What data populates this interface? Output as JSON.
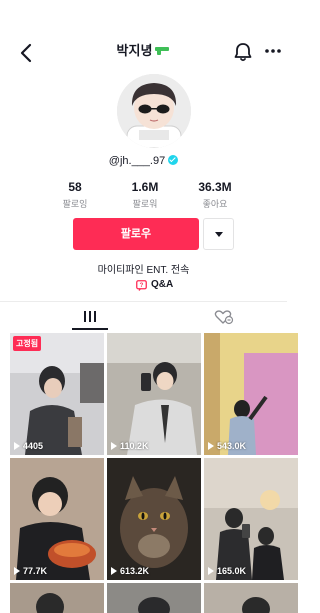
{
  "header": {
    "title": "박지녕"
  },
  "profile": {
    "handle": "@jh.___.97"
  },
  "stats": [
    {
      "value": "58",
      "label": "팔로잉"
    },
    {
      "value": "1.6M",
      "label": "팔로워"
    },
    {
      "value": "36.3M",
      "label": "좋아요"
    }
  ],
  "actions": {
    "follow_label": "팔로우"
  },
  "bio": "마이티파인 ENT. 전속",
  "qa": {
    "label": "Q&A"
  },
  "videos": [
    {
      "views": "4405",
      "badge": "고정됨",
      "caption": ""
    },
    {
      "views": "110.2K",
      "badge": "",
      "caption": ""
    },
    {
      "views": "543.0K",
      "badge": "",
      "caption": ""
    },
    {
      "views": "77.7K",
      "badge": "",
      "caption": ""
    },
    {
      "views": "613.2K",
      "badge": "",
      "caption": ""
    },
    {
      "views": "165.0K",
      "badge": "",
      "caption": ""
    }
  ],
  "colors": {
    "accent": "#fe2c55",
    "verified": "#20d5ec"
  },
  "icons": [
    "back-icon",
    "gun-emoji-icon",
    "bell-icon",
    "more-icon",
    "verified-icon",
    "dropdown-icon",
    "qa-icon",
    "grid-icon",
    "liked-icon",
    "play-icon"
  ]
}
